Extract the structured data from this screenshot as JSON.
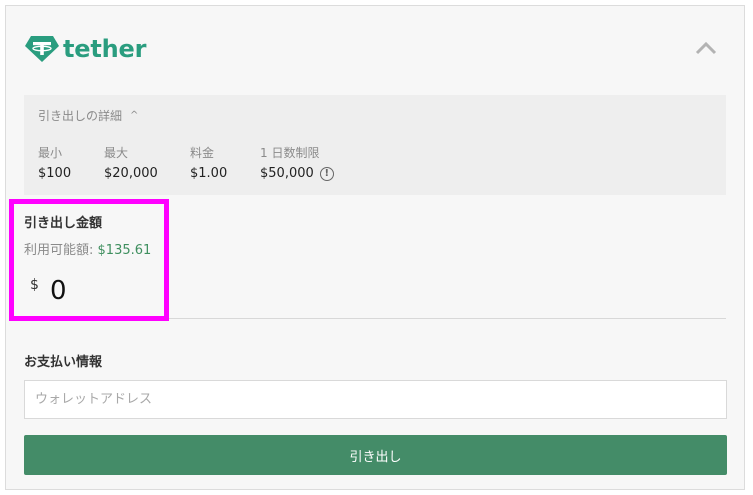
{
  "brand": {
    "name": "tether",
    "color": "#2a9d7f"
  },
  "details": {
    "toggle_label": "引き出しの詳細",
    "limits": [
      {
        "label": "最小",
        "value": "$100"
      },
      {
        "label": "最大",
        "value": "$20,000"
      },
      {
        "label": "料金",
        "value": "$1.00"
      },
      {
        "label": "1 日数制限",
        "value": "$50,000"
      }
    ]
  },
  "amount": {
    "title": "引き出し金額",
    "available_label": "利用可能額:",
    "available_value": "$135.61",
    "currency_symbol": "$",
    "value": "0"
  },
  "payment": {
    "title": "お支払い情報",
    "wallet_placeholder": "ウォレットアドレス",
    "submit_label": "引き出し"
  },
  "colors": {
    "accent": "#448c68",
    "highlight": "#ff00ff",
    "available": "#3f8f5f"
  },
  "icons": {
    "logo": "tether-logo-icon",
    "collapse": "chevron-up-icon",
    "details_caret": "caret-up-icon",
    "info": "info-icon"
  }
}
